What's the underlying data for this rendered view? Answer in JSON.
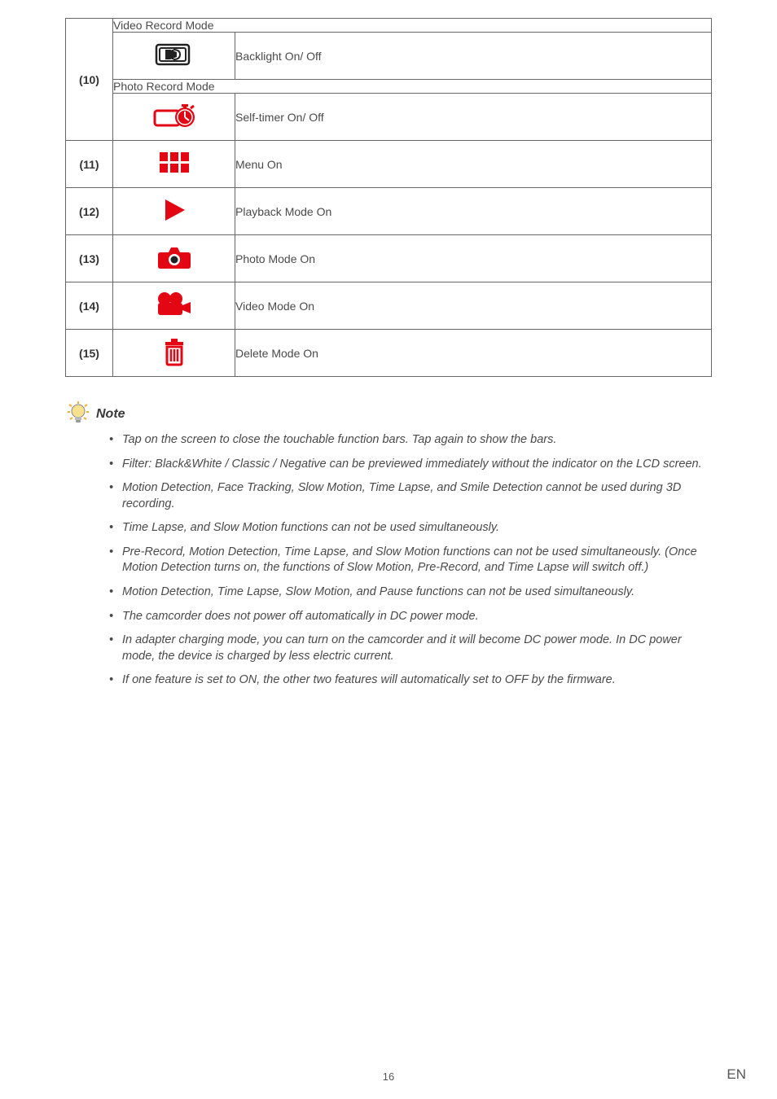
{
  "table": {
    "rows": {
      "r10": {
        "num": "(10)",
        "video_mode_header": "Video Record Mode",
        "video_desc": "Backlight On/ Off",
        "photo_mode_header": "Photo Record Mode",
        "photo_desc": "Self-timer On/ Off"
      },
      "r11": {
        "num": "(11)",
        "desc": "Menu On"
      },
      "r12": {
        "num": "(12)",
        "desc": "Playback Mode On"
      },
      "r13": {
        "num": "(13)",
        "desc": "Photo Mode On"
      },
      "r14": {
        "num": "(14)",
        "desc": "Video Mode On"
      },
      "r15": {
        "num": "(15)",
        "desc": "Delete Mode On"
      }
    }
  },
  "note": {
    "title": "Note",
    "items": [
      "Tap on the screen to close the touchable function bars. Tap again to show the bars.",
      "Filter: Black&White / Classic / Negative can be previewed immediately without the indicator on the LCD screen.",
      "Motion Detection, Face Tracking, Slow Motion, Time Lapse, and Smile Detection cannot be used during 3D recording.",
      "Time Lapse, and Slow Motion functions can not be used simultaneously.",
      "Pre-Record, Motion Detection, Time Lapse, and Slow Motion functions can not be used simultaneously. (Once Motion Detection turns on, the functions of Slow Motion, Pre-Record, and Time Lapse will switch off.)",
      "Motion Detection, Time Lapse, Slow Motion, and Pause functions can not be used simultaneously.",
      "The camcorder does not power off automatically in DC power mode.",
      "In adapter charging mode, you can turn on the camcorder and it will become DC power mode. In DC power mode, the device is charged by less electric current.",
      "If one feature is set to ON, the other two features will automatically set to OFF by the firmware."
    ]
  },
  "footer": {
    "page": "16",
    "lang": "EN"
  }
}
